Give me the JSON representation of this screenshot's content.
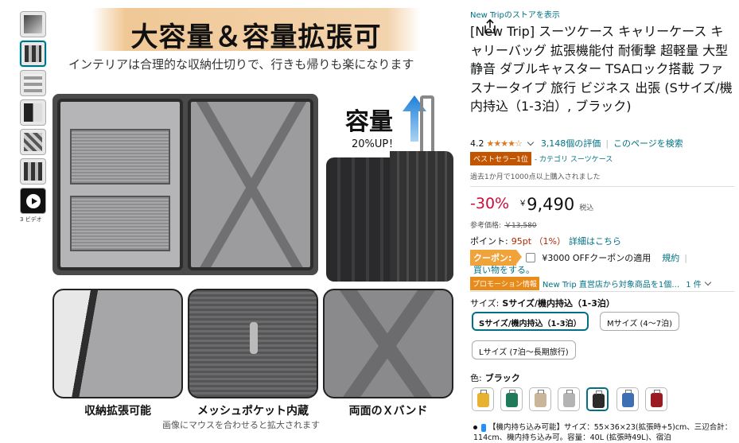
{
  "thumbnails": {
    "video_label": "3 ビデオ"
  },
  "image": {
    "headline": "大容量＆容量拡張可",
    "subline": "インテリアは合理的な収納仕切りで、行きも帰りも楽になります",
    "capacity": "容量",
    "capacity_sub": "20%UP！",
    "captions": [
      "収納拡張可能",
      "メッシュポケット内蔵",
      "両面のＸバンド"
    ],
    "zoom_hint": "画像にマウスを合わせると拡大されます"
  },
  "product": {
    "store_link": "New Tripのストアを表示",
    "title": "[New Trip] スーツケース キャリーケース キャリーバッグ 拡張機能付 耐衝撃 超軽量 大型 静音 ダブルキャスター TSAロック搭載 ファスナータイプ 旅行 ビジネス 出張 (Sサイズ/機内持込（1-3泊）, ブラック)",
    "rating": "4.2",
    "stars": "★★★★☆",
    "review_count": "3,148個の評価",
    "search_page": "このページを検索",
    "bestseller": "ベストセラー1位",
    "category": "- カテゴリ スーツケース",
    "bought": "過去1か月で1000点以上購入されました",
    "discount": "-30%",
    "currency": "￥",
    "price": "9,490",
    "tax": "税込",
    "ref_label": "参考価格:",
    "ref_price": "￥13,580",
    "points_label": "ポイント:",
    "points": "95pt （1%）",
    "points_detail": "詳細はこちら",
    "coupon_tag": "クーポン:",
    "coupon_text": "¥3000 OFFクーポンの適用",
    "coupon_terms": "規約",
    "coupon_sep": "|",
    "shop_link": "買い物をする。",
    "promo_tag": "プロモーション情報",
    "promo_text": "New Trip 直営店から対象商品を1個…",
    "promo_count": "1 件",
    "size_label": "サイズ:",
    "size_selected": "Sサイズ/機内持込（1-3泊）",
    "size_options": [
      "Sサイズ/機内持込（1-3泊）",
      "Mサイズ (4～7泊)",
      "Lサイズ (7泊～長期旅行)"
    ],
    "color_label": "色:",
    "color_selected": "ブラック",
    "feature_text": "【機内持ち込み可能】サイズ：55×36×23(拡張時+5)cm、三辺合計：114cm、機内持ち込み可。容量：40L (拡張時49L)、宿泊"
  },
  "colors": {
    "link": "#007185",
    "price_red": "#cc0c39",
    "star": "#de7921",
    "swatches": [
      "#e6b230",
      "#1f7a5a",
      "#c9b59a",
      "#b3b3b3",
      "#2b2b2b",
      "#3f6fb3",
      "#9a1c22"
    ]
  }
}
